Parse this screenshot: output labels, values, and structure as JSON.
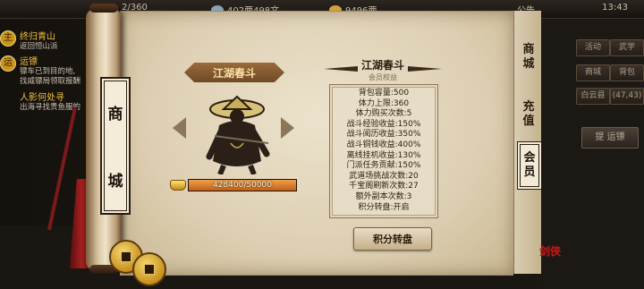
{
  "topbar": {
    "stamina": "2/360",
    "silver": "402两498文",
    "gold": "9496两",
    "notice": "公告",
    "time": "13:43"
  },
  "quests": [
    {
      "badge": "主",
      "title": "终归青山",
      "desc": "返回恒山派"
    },
    {
      "badge": "运",
      "title": "运镖",
      "desc": "镖车已到目的地,\n找威镖局领取报酬"
    },
    {
      "badge": "",
      "title": "人影何处寻",
      "desc": "出海寻找贵鱼服的"
    }
  ],
  "side_buttons": [
    "活动",
    "武学",
    "商城",
    "背包",
    "白云县",
    "(47,43)"
  ],
  "side_button_wide": "提 运镖",
  "shop_tab_label": [
    "商",
    "城"
  ],
  "vip": {
    "name": "江湖春斗",
    "progress_text": "428400/50000",
    "progress_fraction": 1.0
  },
  "benefits": {
    "title": "江湖春斗",
    "subtitle": "会员权益",
    "items": [
      "背包容量:500",
      "体力上限:360",
      "体力购买次数:5",
      "战斗经验收益:150%",
      "战斗阅历收益:350%",
      "战斗铜钱收益:400%",
      "离线挂机收益:130%",
      "门派任务贡献:150%",
      "武道场挑战次数:20",
      "千宝阁刷新次数:27",
      "额外副本次数:3",
      "积分转盘:开启"
    ],
    "button": "积分转盘"
  },
  "tabs": [
    {
      "label": [
        "商",
        "城"
      ],
      "active": false
    },
    {
      "label": [
        "充",
        "值"
      ],
      "active": false
    },
    {
      "label": [
        "会",
        "员"
      ],
      "active": true
    }
  ],
  "seal_text": "剑侠"
}
